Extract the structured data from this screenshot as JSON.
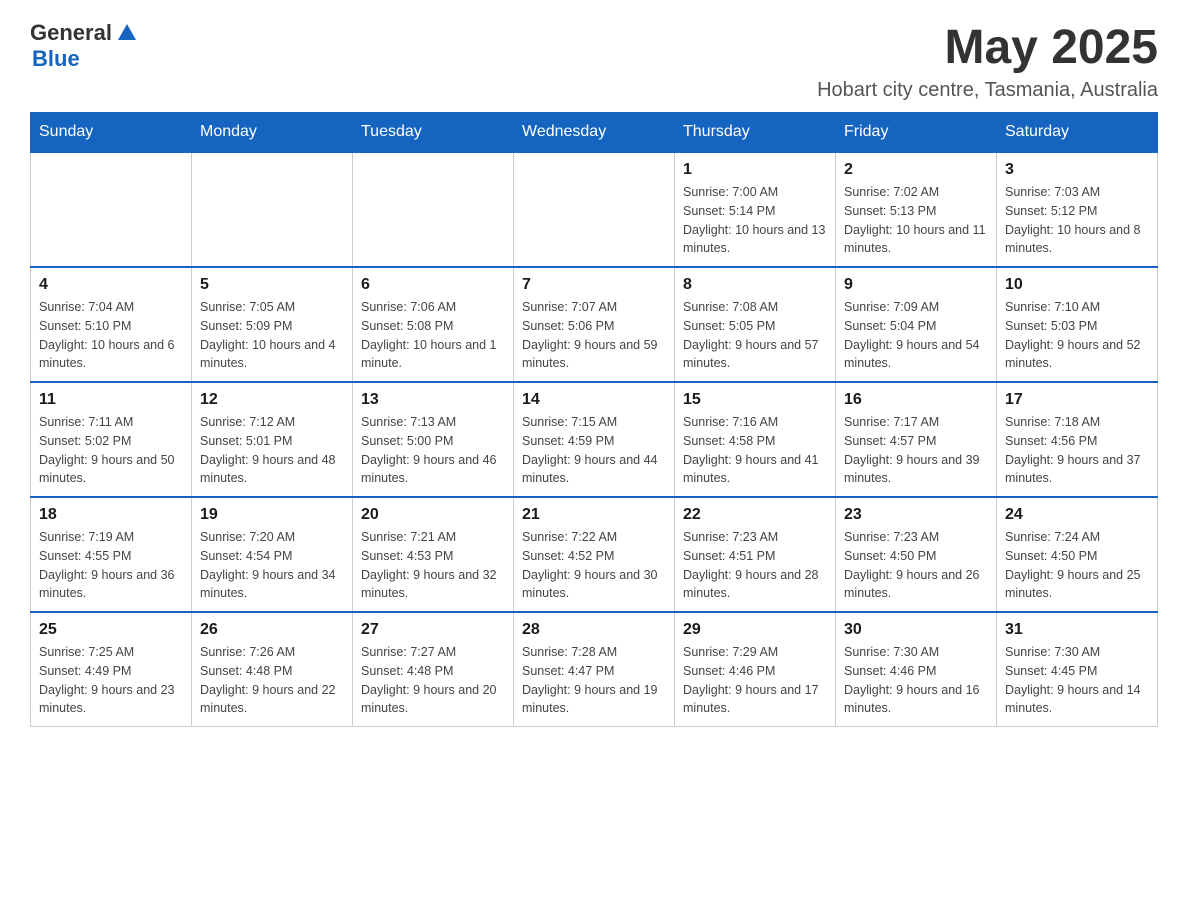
{
  "header": {
    "logo": {
      "general": "General",
      "blue": "Blue"
    },
    "title": "May 2025",
    "location": "Hobart city centre, Tasmania, Australia"
  },
  "days_of_week": [
    "Sunday",
    "Monday",
    "Tuesday",
    "Wednesday",
    "Thursday",
    "Friday",
    "Saturday"
  ],
  "weeks": [
    [
      {
        "day": "",
        "info": ""
      },
      {
        "day": "",
        "info": ""
      },
      {
        "day": "",
        "info": ""
      },
      {
        "day": "",
        "info": ""
      },
      {
        "day": "1",
        "info": "Sunrise: 7:00 AM\nSunset: 5:14 PM\nDaylight: 10 hours and 13 minutes."
      },
      {
        "day": "2",
        "info": "Sunrise: 7:02 AM\nSunset: 5:13 PM\nDaylight: 10 hours and 11 minutes."
      },
      {
        "day": "3",
        "info": "Sunrise: 7:03 AM\nSunset: 5:12 PM\nDaylight: 10 hours and 8 minutes."
      }
    ],
    [
      {
        "day": "4",
        "info": "Sunrise: 7:04 AM\nSunset: 5:10 PM\nDaylight: 10 hours and 6 minutes."
      },
      {
        "day": "5",
        "info": "Sunrise: 7:05 AM\nSunset: 5:09 PM\nDaylight: 10 hours and 4 minutes."
      },
      {
        "day": "6",
        "info": "Sunrise: 7:06 AM\nSunset: 5:08 PM\nDaylight: 10 hours and 1 minute."
      },
      {
        "day": "7",
        "info": "Sunrise: 7:07 AM\nSunset: 5:06 PM\nDaylight: 9 hours and 59 minutes."
      },
      {
        "day": "8",
        "info": "Sunrise: 7:08 AM\nSunset: 5:05 PM\nDaylight: 9 hours and 57 minutes."
      },
      {
        "day": "9",
        "info": "Sunrise: 7:09 AM\nSunset: 5:04 PM\nDaylight: 9 hours and 54 minutes."
      },
      {
        "day": "10",
        "info": "Sunrise: 7:10 AM\nSunset: 5:03 PM\nDaylight: 9 hours and 52 minutes."
      }
    ],
    [
      {
        "day": "11",
        "info": "Sunrise: 7:11 AM\nSunset: 5:02 PM\nDaylight: 9 hours and 50 minutes."
      },
      {
        "day": "12",
        "info": "Sunrise: 7:12 AM\nSunset: 5:01 PM\nDaylight: 9 hours and 48 minutes."
      },
      {
        "day": "13",
        "info": "Sunrise: 7:13 AM\nSunset: 5:00 PM\nDaylight: 9 hours and 46 minutes."
      },
      {
        "day": "14",
        "info": "Sunrise: 7:15 AM\nSunset: 4:59 PM\nDaylight: 9 hours and 44 minutes."
      },
      {
        "day": "15",
        "info": "Sunrise: 7:16 AM\nSunset: 4:58 PM\nDaylight: 9 hours and 41 minutes."
      },
      {
        "day": "16",
        "info": "Sunrise: 7:17 AM\nSunset: 4:57 PM\nDaylight: 9 hours and 39 minutes."
      },
      {
        "day": "17",
        "info": "Sunrise: 7:18 AM\nSunset: 4:56 PM\nDaylight: 9 hours and 37 minutes."
      }
    ],
    [
      {
        "day": "18",
        "info": "Sunrise: 7:19 AM\nSunset: 4:55 PM\nDaylight: 9 hours and 36 minutes."
      },
      {
        "day": "19",
        "info": "Sunrise: 7:20 AM\nSunset: 4:54 PM\nDaylight: 9 hours and 34 minutes."
      },
      {
        "day": "20",
        "info": "Sunrise: 7:21 AM\nSunset: 4:53 PM\nDaylight: 9 hours and 32 minutes."
      },
      {
        "day": "21",
        "info": "Sunrise: 7:22 AM\nSunset: 4:52 PM\nDaylight: 9 hours and 30 minutes."
      },
      {
        "day": "22",
        "info": "Sunrise: 7:23 AM\nSunset: 4:51 PM\nDaylight: 9 hours and 28 minutes."
      },
      {
        "day": "23",
        "info": "Sunrise: 7:23 AM\nSunset: 4:50 PM\nDaylight: 9 hours and 26 minutes."
      },
      {
        "day": "24",
        "info": "Sunrise: 7:24 AM\nSunset: 4:50 PM\nDaylight: 9 hours and 25 minutes."
      }
    ],
    [
      {
        "day": "25",
        "info": "Sunrise: 7:25 AM\nSunset: 4:49 PM\nDaylight: 9 hours and 23 minutes."
      },
      {
        "day": "26",
        "info": "Sunrise: 7:26 AM\nSunset: 4:48 PM\nDaylight: 9 hours and 22 minutes."
      },
      {
        "day": "27",
        "info": "Sunrise: 7:27 AM\nSunset: 4:48 PM\nDaylight: 9 hours and 20 minutes."
      },
      {
        "day": "28",
        "info": "Sunrise: 7:28 AM\nSunset: 4:47 PM\nDaylight: 9 hours and 19 minutes."
      },
      {
        "day": "29",
        "info": "Sunrise: 7:29 AM\nSunset: 4:46 PM\nDaylight: 9 hours and 17 minutes."
      },
      {
        "day": "30",
        "info": "Sunrise: 7:30 AM\nSunset: 4:46 PM\nDaylight: 9 hours and 16 minutes."
      },
      {
        "day": "31",
        "info": "Sunrise: 7:30 AM\nSunset: 4:45 PM\nDaylight: 9 hours and 14 minutes."
      }
    ]
  ]
}
